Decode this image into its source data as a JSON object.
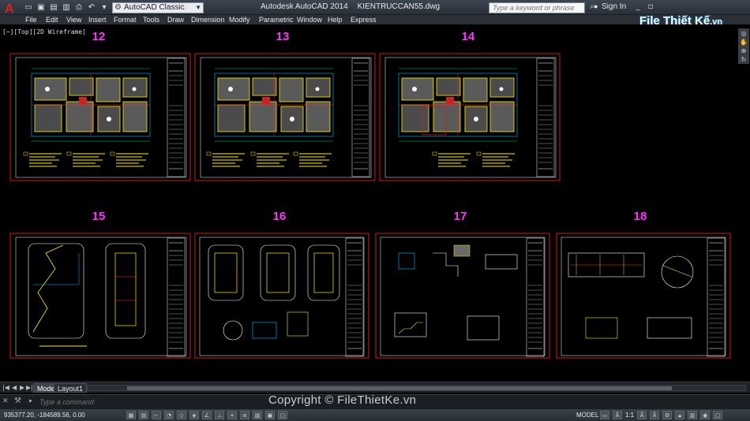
{
  "titlebar": {
    "workspace": "AutoCAD Classic",
    "app_title": "Autodesk AutoCAD 2014",
    "file_name": "KIENTRUCCAN55.dwg",
    "search_placeholder": "Type a keyword or phrase",
    "sign_in": "Sign In"
  },
  "menu": [
    "File",
    "Edit",
    "View",
    "Insert",
    "Format",
    "Tools",
    "Draw",
    "Dimension",
    "Modify",
    "Parametric",
    "Window",
    "Help",
    "Express"
  ],
  "brand": {
    "name": "File Thiết Kế",
    "tld": ".vn"
  },
  "viewport_label": "[−][Top][2D Wireframe]",
  "sheets": [
    {
      "number": "12"
    },
    {
      "number": "13"
    },
    {
      "number": "14"
    },
    {
      "number": "15"
    },
    {
      "number": "16"
    },
    {
      "number": "17"
    },
    {
      "number": "18"
    }
  ],
  "tabs": [
    "Model",
    "Layout1"
  ],
  "command": {
    "placeholder": "Type a command"
  },
  "watermark": "Copyright © FileThietKe.vn",
  "status": {
    "coordinates": "935377.20, -184589.56, 0.00",
    "model": "MODEL",
    "scale": "1:1"
  },
  "colors": {
    "sheet_border": "#d01818",
    "sheet_number": "#ff33ff",
    "brand_outline": "#0a5a8a"
  }
}
